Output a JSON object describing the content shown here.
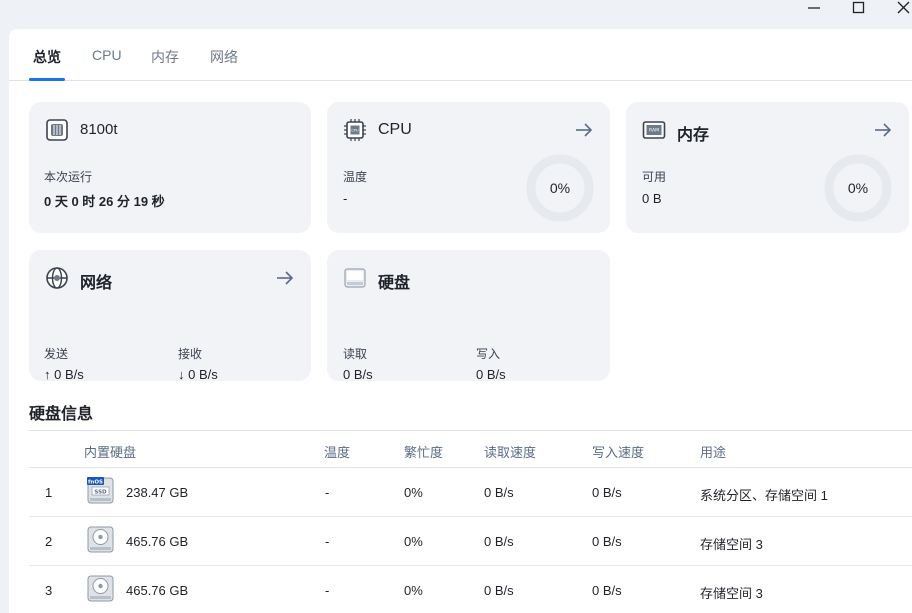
{
  "window": {
    "minimize_icon": "minimize-icon",
    "maximize_icon": "maximize-icon",
    "close_icon": "close-icon"
  },
  "tabs": [
    {
      "label": "总览",
      "active": true
    },
    {
      "label": "CPU",
      "active": false
    },
    {
      "label": "内存",
      "active": false
    },
    {
      "label": "网络",
      "active": false
    }
  ],
  "colors": {
    "accent": "#1a73e8",
    "card_bg": "#f1f3f7",
    "ring_track": "#e6e9ee",
    "arrow": "#5b6b85"
  },
  "cards": {
    "device": {
      "icon": "server-icon",
      "title": "8100t",
      "uptime_label": "本次运行",
      "uptime_value": "0 天 0 时 26 分 19 秒"
    },
    "cpu": {
      "icon": "cpu-chip-icon",
      "title": "CPU",
      "temp_label": "温度",
      "temp_value": "-",
      "usage_text": "0%",
      "usage_fraction": 0
    },
    "memory": {
      "icon": "ram-icon",
      "title": "内存",
      "available_label": "可用",
      "available_value": "0 B",
      "usage_text": "0%",
      "usage_fraction": 0
    },
    "network": {
      "icon": "globe-network-icon",
      "title": "网络",
      "send_label": "发送",
      "send_value": "↑ 0 B/s",
      "recv_label": "接收",
      "recv_value": "↓ 0 B/s"
    },
    "disk": {
      "icon": "disk-drive-icon",
      "title": "硬盘",
      "read_label": "读取",
      "read_value": "0 B/s",
      "write_label": "写入",
      "write_value": "0 B/s"
    }
  },
  "disk_info": {
    "title": "硬盘信息",
    "columns": [
      "内置硬盘",
      "温度",
      "繁忙度",
      "读取速度",
      "写入速度",
      "用途"
    ],
    "rows": [
      {
        "index": "1",
        "icon": "ssd-icon",
        "badge": "fnOS",
        "badge_sub": "SSD",
        "capacity": "238.47 GB",
        "temp": "-",
        "busy": "0%",
        "read": "0 B/s",
        "write": "0 B/s",
        "usage": "系统分区、存储空间 1"
      },
      {
        "index": "2",
        "icon": "hdd-icon",
        "capacity": "465.76 GB",
        "temp": "-",
        "busy": "0%",
        "read": "0 B/s",
        "write": "0 B/s",
        "usage": "存储空间 3"
      },
      {
        "index": "3",
        "icon": "hdd-icon",
        "capacity": "465.76 GB",
        "temp": "-",
        "busy": "0%",
        "read": "0 B/s",
        "write": "0 B/s",
        "usage": "存储空间 3"
      }
    ]
  }
}
